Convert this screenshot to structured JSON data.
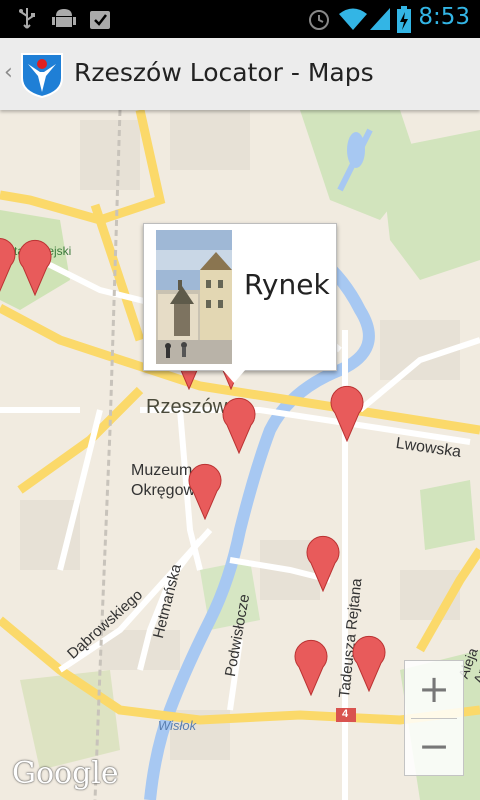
{
  "status_bar": {
    "time": "8:53",
    "icons": [
      "usb-icon",
      "android-debug-icon",
      "checklist-icon",
      "alarm-icon",
      "wifi-icon",
      "signal-icon",
      "battery-charging-icon"
    ],
    "time_color": "#33b5e5"
  },
  "action_bar": {
    "title": "Rzeszów Locator - Maps",
    "up_glyph": "‹",
    "logo": "rzeszow-coat-of-arms-icon"
  },
  "map": {
    "labels": {
      "city": "Rzeszów",
      "district": "Staromiejskie",
      "museum_1": "Muzeum",
      "museum_2": "Okręgowe",
      "lwowska": "Lwowska",
      "dabrowskiego": "Dąbrowskiego",
      "hetmanska": "Hetmańska",
      "podwislocze": "Podwisłocze",
      "rejtana": "Tadeusza Rejtana",
      "armii": "Aleja Armii",
      "wislok": "Wisłok",
      "road_number": "4",
      "attribution": "Google"
    },
    "popup": {
      "title": "Rynek",
      "image": "rynek-town-hall-photo"
    },
    "marker_color": "#e85b5b",
    "zoom": {
      "in": "+",
      "out": "−"
    }
  }
}
